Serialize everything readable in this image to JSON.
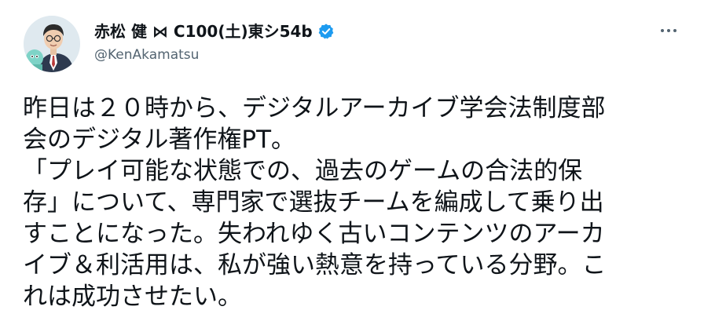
{
  "author": {
    "display_name": "赤松 健 ⋈ C100(土)東シ54b",
    "handle": "@KenAkamatsu",
    "verified": true
  },
  "tweet": {
    "lines": [
      "昨日は２０時から、デジタルアーカイブ学会法制度部",
      "会のデジタル著作権PT。",
      "「プレイ可能な状態での、過去のゲームの合法的保",
      "存」について、専門家で選抜チームを編成して乗り出",
      "すことになった。失われゆく古いコンテンツのアーカ",
      "イブ＆利活用は、私が強い熱意を持っている分野。こ",
      "れは成功させたい。"
    ]
  },
  "icons": {
    "more": "more-dots-icon",
    "verified": "verified-badge-icon"
  },
  "colors": {
    "verified": "#1d9bf0",
    "text": "#0f1419",
    "secondary": "#536471"
  }
}
